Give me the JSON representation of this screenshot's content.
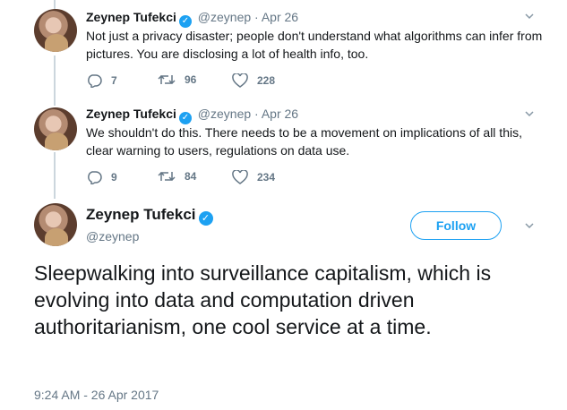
{
  "tweets": [
    {
      "name": "Zeynep Tufekci",
      "handle": "@zeynep",
      "separator": "·",
      "date": "Apr 26",
      "text": "Not just a privacy disaster; people don't understand what algorithms can infer from pictures. You are disclosing a lot of health info, too.",
      "replies": "7",
      "retweets": "96",
      "likes": "228"
    },
    {
      "name": "Zeynep Tufekci",
      "handle": "@zeynep",
      "separator": "·",
      "date": "Apr 26",
      "text": "We shouldn't do this. There needs to be a movement on implications of all this, clear warning to users, regulations on data use.",
      "replies": "9",
      "retweets": "84",
      "likes": "234"
    }
  ],
  "main_tweet": {
    "name": "Zeynep Tufekci",
    "handle": "@zeynep",
    "follow_label": "Follow",
    "text": "Sleepwalking into surveillance capitalism, which is evolving into data and computation driven authoritarianism, one cool service at a time.",
    "timestamp": "9:24 AM - 26 Apr 2017"
  },
  "colors": {
    "accent": "#1da1f2",
    "secondary_text": "#657786",
    "thread_line": "#ccd6dd"
  }
}
